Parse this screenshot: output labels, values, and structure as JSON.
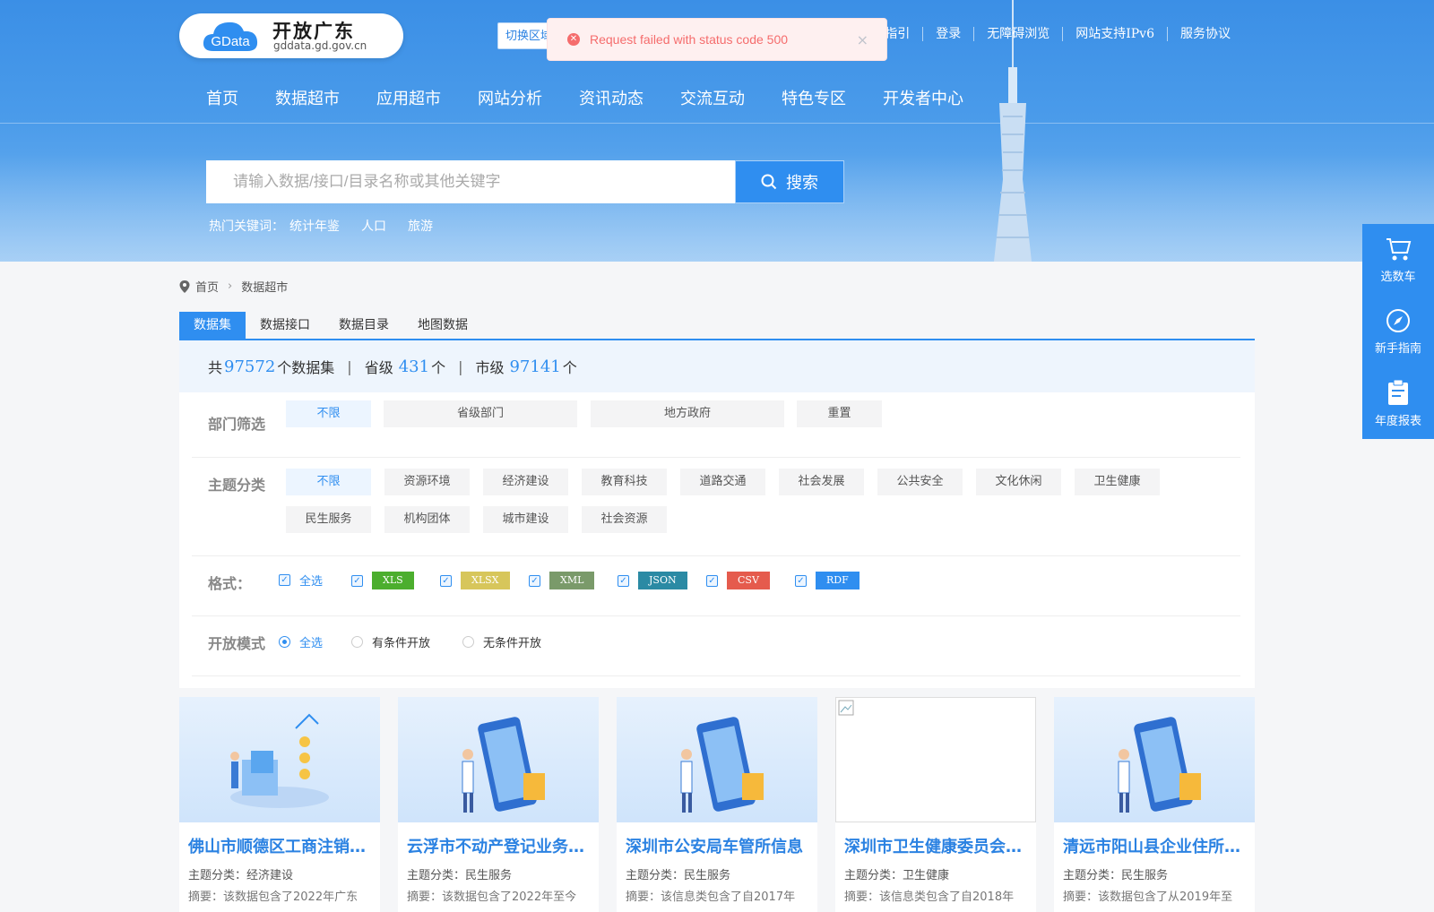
{
  "logo": {
    "brand": "开放广东",
    "domain": "gddata.gd.gov.cn",
    "mark": "GData"
  },
  "header": {
    "region_switch": "切换区域",
    "links": [
      "指引",
      "登录",
      "无障碍浏览",
      "网站支持IPv6",
      "服务协议"
    ]
  },
  "toast": {
    "message": "Request failed with status code 500",
    "type": "error",
    "close": "×"
  },
  "nav": [
    "首页",
    "数据超市",
    "应用超市",
    "网站分析",
    "资讯动态",
    "交流互动",
    "特色专区",
    "开发者中心"
  ],
  "search": {
    "placeholder": "请输入数据/接口/目录名称或其他关键字",
    "button": "搜索"
  },
  "hot_keywords": {
    "label": "热门关键词：",
    "items": [
      "统计年鉴",
      "人口",
      "旅游"
    ]
  },
  "breadcrumb": [
    "首页",
    "数据超市"
  ],
  "tabs": [
    "数据集",
    "数据接口",
    "数据目录",
    "地图数据"
  ],
  "active_tab": "数据集",
  "stats": {
    "prefix": "共",
    "total": "97572",
    "total_unit": "个数据集",
    "sep": "|",
    "province_label": "省级",
    "province": "431",
    "province_unit": "个",
    "city_label": "市级",
    "city": "97141",
    "city_unit": "个"
  },
  "filters": {
    "dept": {
      "title": "部门筛选",
      "options": [
        "不限",
        "省级部门",
        "地方政府",
        "重置"
      ],
      "selected": "不限"
    },
    "topic": {
      "title": "主题分类",
      "options": [
        "不限",
        "资源环境",
        "经济建设",
        "教育科技",
        "道路交通",
        "社会发展",
        "公共安全",
        "文化休闲",
        "卫生健康",
        "民生服务",
        "机构团体",
        "城市建设",
        "社会资源"
      ],
      "selected": "不限"
    },
    "format": {
      "title": "格式：",
      "all": "全选",
      "items": [
        {
          "label": "XLS",
          "color": "#4cae2e"
        },
        {
          "label": "XLSX",
          "color": "#d7c65b"
        },
        {
          "label": "XML",
          "color": "#7a9a6a"
        },
        {
          "label": "JSON",
          "color": "#2b8aa4"
        },
        {
          "label": "CSV",
          "color": "#e55b4d"
        },
        {
          "label": "RDF",
          "color": "#2f8ef0"
        }
      ]
    },
    "mode": {
      "title": "开放模式",
      "options": [
        "全选",
        "有条件开放",
        "无条件开放"
      ],
      "selected": "全选"
    }
  },
  "cards": [
    {
      "title": "佛山市顺德区工商注销企业信息",
      "category": "主题分类：经济建设",
      "abstract": "摘要：该数据包含了2022年广东",
      "image": "blocks"
    },
    {
      "title": "云浮市不动产登记业务信息",
      "category": "主题分类：民生服务",
      "abstract": "摘要：该数据包含了2022年至今",
      "image": "phone"
    },
    {
      "title": "深圳市公安局车管所信息",
      "category": "主题分类：民生服务",
      "abstract": "摘要：该信息类包含了自2017年",
      "image": "phone"
    },
    {
      "title": "深圳市卫生健康委员会医疗机构",
      "category": "主题分类：卫生健康",
      "abstract": "摘要：该信息类包含了自2018年",
      "image": "broken"
    },
    {
      "title": "清远市阳山县企业住所信息",
      "category": "主题分类：民生服务",
      "abstract": "摘要：该数据包含了从2019年至",
      "image": "phone"
    }
  ],
  "sidebar": [
    {
      "label": "选数车",
      "icon": "cart-icon"
    },
    {
      "label": "新手指南",
      "icon": "compass-icon"
    },
    {
      "label": "年度报表",
      "icon": "report-icon"
    }
  ],
  "colors": {
    "primary": "#2f8ef0",
    "error": "#f56c6c",
    "hero": "#3b8fe6"
  }
}
